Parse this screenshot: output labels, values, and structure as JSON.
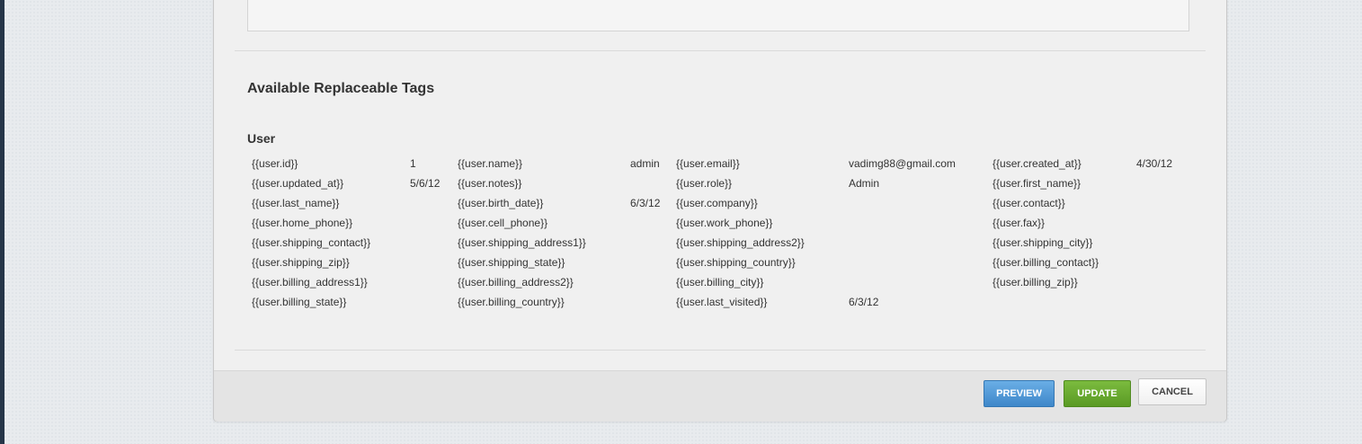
{
  "section_title": "Available Replaceable Tags",
  "group_title": "User",
  "tags": [
    {
      "tag": "{{user.id}}",
      "value": "1"
    },
    {
      "tag": "{{user.name}}",
      "value": "admin"
    },
    {
      "tag": "{{user.email}}",
      "value": "vadimg88@gmail.com"
    },
    {
      "tag": "{{user.created_at}}",
      "value": "4/30/12"
    },
    {
      "tag": "{{user.updated_at}}",
      "value": "5/6/12"
    },
    {
      "tag": "{{user.notes}}",
      "value": ""
    },
    {
      "tag": "{{user.role}}",
      "value": "Admin"
    },
    {
      "tag": "{{user.first_name}}",
      "value": ""
    },
    {
      "tag": "{{user.last_name}}",
      "value": ""
    },
    {
      "tag": "{{user.birth_date}}",
      "value": "6/3/12"
    },
    {
      "tag": "{{user.company}}",
      "value": ""
    },
    {
      "tag": "{{user.contact}}",
      "value": ""
    },
    {
      "tag": "{{user.home_phone}}",
      "value": ""
    },
    {
      "tag": "{{user.cell_phone}}",
      "value": ""
    },
    {
      "tag": "{{user.work_phone}}",
      "value": ""
    },
    {
      "tag": "{{user.fax}}",
      "value": ""
    },
    {
      "tag": "{{user.shipping_contact}}",
      "value": ""
    },
    {
      "tag": "{{user.shipping_address1}}",
      "value": ""
    },
    {
      "tag": "{{user.shipping_address2}}",
      "value": ""
    },
    {
      "tag": "{{user.shipping_city}}",
      "value": ""
    },
    {
      "tag": "{{user.shipping_zip}}",
      "value": ""
    },
    {
      "tag": "{{user.shipping_state}}",
      "value": ""
    },
    {
      "tag": "{{user.shipping_country}}",
      "value": ""
    },
    {
      "tag": "{{user.billing_contact}}",
      "value": ""
    },
    {
      "tag": "{{user.billing_address1}}",
      "value": ""
    },
    {
      "tag": "{{user.billing_address2}}",
      "value": ""
    },
    {
      "tag": "{{user.billing_city}}",
      "value": ""
    },
    {
      "tag": "{{user.billing_zip}}",
      "value": ""
    },
    {
      "tag": "{{user.billing_state}}",
      "value": ""
    },
    {
      "tag": "{{user.billing_country}}",
      "value": ""
    },
    {
      "tag": "{{user.last_visited}}",
      "value": "6/3/12"
    }
  ],
  "buttons": {
    "preview": "PREVIEW",
    "update": "UPDATE",
    "cancel": "CANCEL"
  },
  "colors": {
    "preview": "#4a90d9",
    "update": "#66a82e",
    "panel": "#f0f0f0",
    "footer": "#e4e4e4"
  }
}
